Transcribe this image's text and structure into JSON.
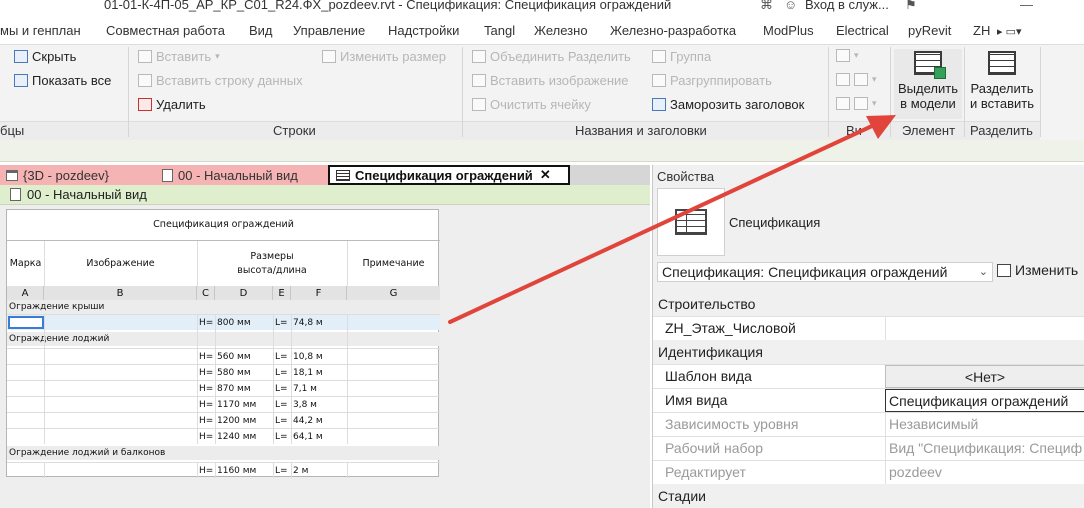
{
  "window": {
    "file_name": "01-01-К-4П-05_АР_КР_С01_R24.ФХ_pozdeev.rvt - Спецификация: Спецификация ограждений",
    "sign_in": "Вход в служ..."
  },
  "ribbon_tabs": [
    "мы и генплан",
    "Совместная работа",
    "Вид",
    "Управление",
    "Надстройки",
    "Tangl",
    "Железно",
    "Железно-разработка",
    "ModPlus",
    "Electrical",
    "pyRevit",
    "ZH"
  ],
  "ribbon": {
    "columns_panel": {
      "hide": "Скрыть",
      "show_all": "Показать  все",
      "title": "бцы"
    },
    "rows_panel": {
      "insert": "Вставить",
      "insert_data_row": "Вставить  строку данных",
      "delete": "Удалить",
      "resize": "Изменить размер",
      "title": "Строки"
    },
    "headers_panel": {
      "merge_unmerge": "Объединить  Разделить",
      "group": "Группа",
      "insert_image": "Вставить  изображение",
      "ungroup": "Разгруппировать",
      "clear_cell": "Очистить  ячейку",
      "freeze_header": "Заморозить  заголовок",
      "title": "Названия и заголовки"
    },
    "appearance_panel": {
      "title": "Ви"
    },
    "element_panel": {
      "select_in_model_1": "Выделить",
      "select_in_model_2": "в модели",
      "title": "Элемент"
    },
    "split_panel": {
      "split_1": "Разделить",
      "split_2": "и вставить",
      "title": "Разделить"
    }
  },
  "view_tabs": [
    {
      "label": "{3D - pozdeev}",
      "state": "inactive"
    },
    {
      "label": "00 - Начальный вид",
      "state": "inactive"
    },
    {
      "label": "Спецификация ограждений",
      "state": "active"
    }
  ],
  "secondary_tab": "00 - Начальный вид",
  "schedule": {
    "title": "Спецификация ограждений",
    "headers": {
      "mark": "Марка",
      "image": "Изображение",
      "size_1": "Размеры",
      "size_2": "высота/длина",
      "note": "Примечание"
    },
    "letters": [
      "A",
      "B",
      "C",
      "D",
      "E",
      "F",
      "G"
    ],
    "groups": [
      {
        "name": "Ограждение крыши",
        "rows": [
          {
            "h": "H=",
            "hv": "800 мм",
            "l": "L=",
            "lv": "74,8 м"
          }
        ]
      },
      {
        "name": "Ограждение лоджий",
        "rows": [
          {
            "h": "H=",
            "hv": "560 мм",
            "l": "L=",
            "lv": "10,8 м"
          },
          {
            "h": "H=",
            "hv": "580 мм",
            "l": "L=",
            "lv": "18,1 м"
          },
          {
            "h": "H=",
            "hv": "870 мм",
            "l": "L=",
            "lv": "7,1 м"
          },
          {
            "h": "H=",
            "hv": "1170 мм",
            "l": "L=",
            "lv": "3,8 м"
          },
          {
            "h": "H=",
            "hv": "1200 мм",
            "l": "L=",
            "lv": "44,2 м"
          },
          {
            "h": "H=",
            "hv": "1240 мм",
            "l": "L=",
            "lv": "64,1 м"
          }
        ]
      },
      {
        "name": "Ограждение лоджий и балконов",
        "rows": [
          {
            "h": "H=",
            "hv": "1160 мм",
            "l": "L=",
            "lv": "2 м"
          }
        ]
      }
    ]
  },
  "properties": {
    "title": "Свойства",
    "type_name": "Спецификация",
    "type_selector": "Спецификация: Спецификация ограждений",
    "edit_type": "Изменить",
    "categories": {
      "construction": "Строительство",
      "identity": "Идентификация",
      "phases": "Стадии"
    },
    "rows": {
      "zh_floor": {
        "label": "ZH_Этаж_Числовой",
        "value": ""
      },
      "view_template": {
        "label": "Шаблон вида",
        "value": "<Нет>"
      },
      "view_name": {
        "label": "Имя вида",
        "value": "Спецификация ограждений"
      },
      "dependency": {
        "label": "Зависимость уровня",
        "value": "Независимый"
      },
      "workset": {
        "label": "Рабочий набор",
        "value": "Вид \"Спецификация: Специф"
      },
      "edited_by": {
        "label": "Редактирует",
        "value": "pozdeev"
      }
    }
  },
  "annotation_color": "#e0443a"
}
